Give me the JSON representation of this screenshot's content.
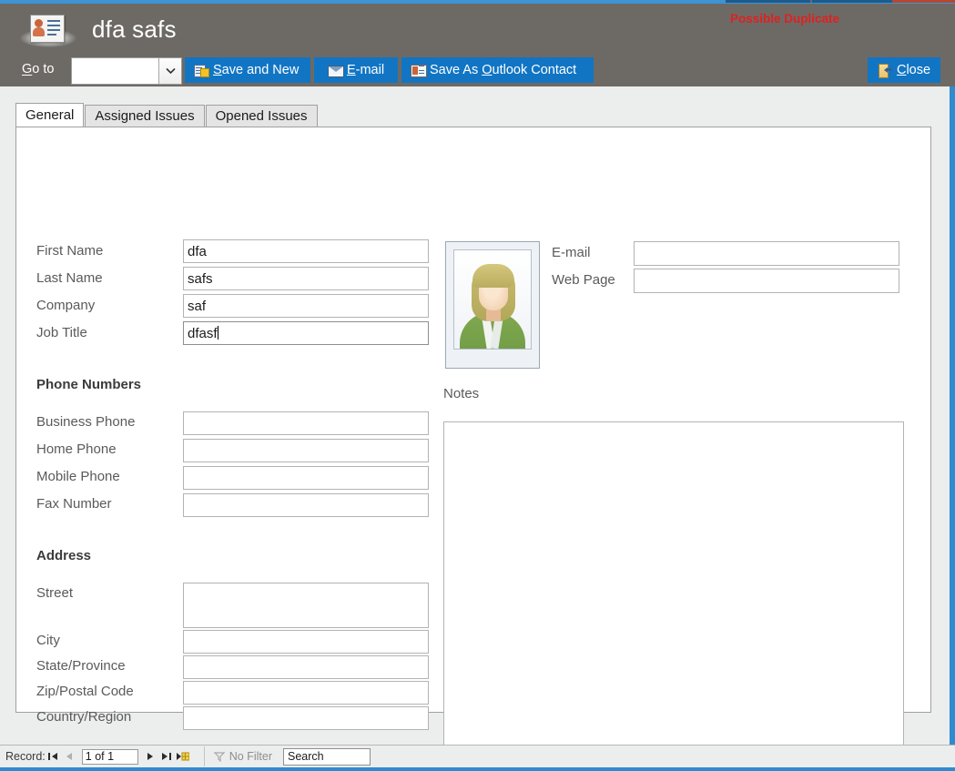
{
  "window": {
    "title": "dfa safs",
    "icon": "contact-card-icon",
    "duplicate_warning": "Possible Duplicate",
    "header_bg": "#6d6a65",
    "accent_blue": "#2e8bd0",
    "button_blue": "#1175c4",
    "warning_color": "#e02020"
  },
  "toolbar": {
    "goto_label": "Go to",
    "goto_value": "",
    "goto_dropdown_icon": "chevron-down-icon",
    "buttons": [
      {
        "id": "save-and-new",
        "label": "Save and New",
        "accesskey": "S",
        "icon": "save-new-icon"
      },
      {
        "id": "email",
        "label": "E-mail",
        "accesskey": "E",
        "icon": "envelope-icon"
      },
      {
        "id": "save-as-outlook-contact",
        "label": "Save As Outlook Contact",
        "accesskey": "O",
        "icon": "outlook-contact-icon"
      },
      {
        "id": "close",
        "label": "Close",
        "accesskey": "C",
        "icon": "close-door-icon"
      }
    ]
  },
  "tabs": [
    {
      "id": "general",
      "label": "General",
      "active": true
    },
    {
      "id": "assigned-issues",
      "label": "Assigned Issues",
      "active": false
    },
    {
      "id": "opened-issues",
      "label": "Opened Issues",
      "active": false
    }
  ],
  "form": {
    "identity": {
      "fields": [
        {
          "id": "first-name",
          "label": "First Name",
          "value": "dfa",
          "focused": false
        },
        {
          "id": "last-name",
          "label": "Last Name",
          "value": "safs",
          "focused": false
        },
        {
          "id": "company",
          "label": "Company",
          "value": "saf",
          "focused": false
        },
        {
          "id": "job-title",
          "label": "Job Title",
          "value": "dfasf",
          "focused": true
        }
      ]
    },
    "phone_section": {
      "heading": "Phone Numbers",
      "fields": [
        {
          "id": "business-phone",
          "label": "Business Phone",
          "value": ""
        },
        {
          "id": "home-phone",
          "label": "Home Phone",
          "value": ""
        },
        {
          "id": "mobile-phone",
          "label": "Mobile Phone",
          "value": ""
        },
        {
          "id": "fax-number",
          "label": "Fax Number",
          "value": ""
        }
      ]
    },
    "address_section": {
      "heading": "Address",
      "fields": [
        {
          "id": "street",
          "label": "Street",
          "value": ""
        },
        {
          "id": "city",
          "label": "City",
          "value": ""
        },
        {
          "id": "state-province",
          "label": "State/Province",
          "value": ""
        },
        {
          "id": "zip-postal-code",
          "label": "Zip/Postal Code",
          "value": ""
        },
        {
          "id": "country-region",
          "label": "Country/Region",
          "value": ""
        }
      ]
    },
    "contact_section": {
      "fields": [
        {
          "id": "e-mail",
          "label": "E-mail",
          "value": ""
        },
        {
          "id": "web-page",
          "label": "Web Page",
          "value": ""
        }
      ]
    },
    "notes": {
      "label": "Notes",
      "value": ""
    },
    "photo": {
      "alt": "contact-photo",
      "value": "default-person-photo"
    }
  },
  "status_bar": {
    "record_label": "Record:",
    "record_position": "1 of 1",
    "first_record_icon": "first-record-icon",
    "previous_record_icon": "previous-record-icon",
    "next_record_icon": "next-record-icon",
    "last_record_icon": "last-record-icon",
    "new_record_icon": "new-record-icon",
    "filter_icon": "filter-icon",
    "filter_label": "No Filter",
    "search_placeholder": "Search",
    "search_value": "Search"
  }
}
